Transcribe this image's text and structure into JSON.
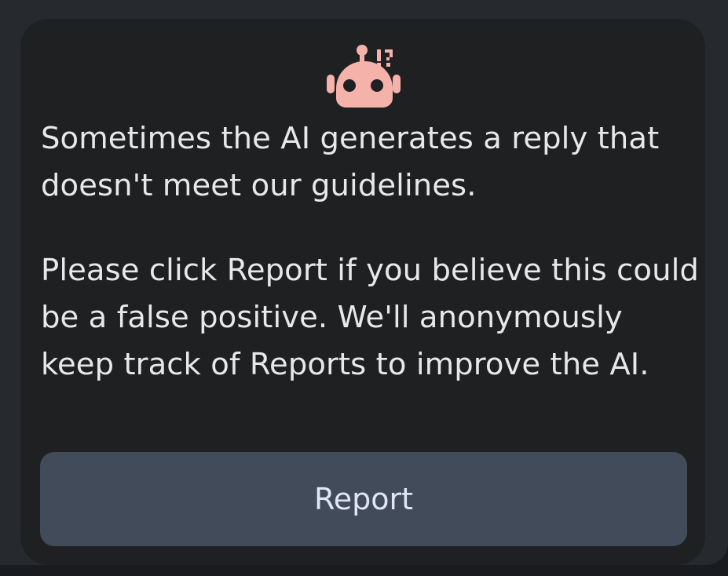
{
  "notice": {
    "icon": "robot-warning-icon",
    "paragraph_1": "Sometimes the AI generates a reply that doesn't meet our guidelines.",
    "paragraph_2": "Please click Report if you believe this could be a false positive. We'll anonymously keep track of Reports to improve the AI."
  },
  "actions": {
    "report_label": "Report"
  },
  "colors": {
    "icon": "#f4b2ab",
    "card_background": "#1f2022",
    "button_background": "#414b5a",
    "text": "#e7e8ea"
  }
}
